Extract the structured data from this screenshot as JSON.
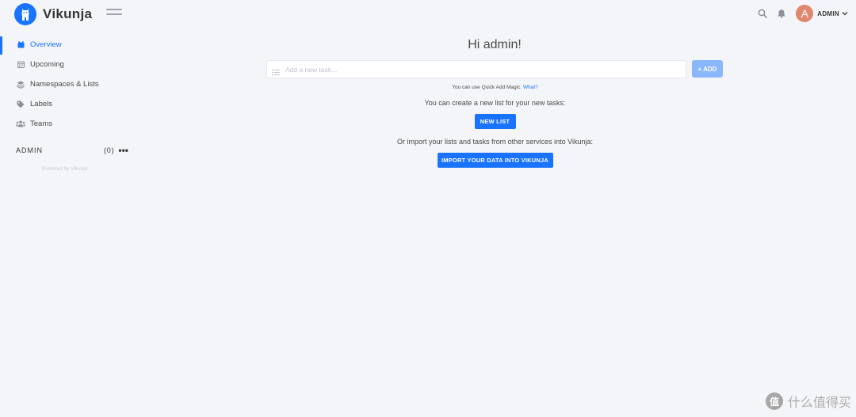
{
  "app": {
    "name": "Vikunja",
    "accent_color": "#1973ff"
  },
  "header": {
    "icons": [
      "search-icon",
      "bell-icon"
    ],
    "user": {
      "avatar_letter": "A",
      "name": "ADMIN"
    }
  },
  "sidebar": {
    "items": [
      {
        "label": "Overview",
        "icon": "calendar-icon",
        "active": true
      },
      {
        "label": "Upcoming",
        "icon": "calendar-grid-icon",
        "active": false
      },
      {
        "label": "Namespaces & Lists",
        "icon": "layers-icon",
        "active": false
      },
      {
        "label": "Labels",
        "icon": "tags-icon",
        "active": false
      },
      {
        "label": "Teams",
        "icon": "users-icon",
        "active": false
      }
    ],
    "namespace": {
      "name": "ADMIN",
      "count": "(0)"
    },
    "powered_by": "Powered by Vikunja"
  },
  "main": {
    "greeting": "Hi admin!",
    "add_task": {
      "placeholder": "Add a new task...",
      "value": "",
      "button_label": "+ ADD"
    },
    "quick_add_hint": {
      "text": "You can use Quick Add Magic.",
      "link": "What?"
    },
    "new_list_prompt": "You can create a new list for your new tasks:",
    "new_list_button": "NEW LIST",
    "import_prompt": "Or import your lists and tasks from other services into Vikunja:",
    "import_button": "IMPORT YOUR DATA INTO VIKUNJA"
  },
  "watermark": {
    "badge": "值",
    "text": "什么值得买"
  }
}
